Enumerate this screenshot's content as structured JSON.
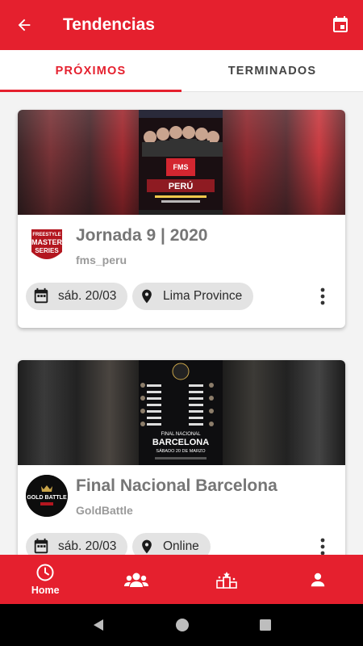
{
  "app_bar": {
    "title": "Tendencias",
    "back_icon": "arrow-back-icon",
    "calendar_icon": "calendar-icon"
  },
  "tabs": [
    {
      "label": "PRÓXIMOS",
      "active": true
    },
    {
      "label": "TERMINADOS",
      "active": false
    }
  ],
  "events": [
    {
      "title": "Jornada 9 | 2020",
      "organizer": "fms_peru",
      "logo_text": [
        "FREESTYLE",
        "MASTER",
        "SERIES"
      ],
      "date": "sáb. 20/03",
      "location": "Lima Province",
      "poster_text": [
        "FMS",
        "PERÚ"
      ]
    },
    {
      "title": "Final Nacional Barcelona",
      "organizer": "GoldBattle",
      "logo_text": [
        "GOLD BATTLE"
      ],
      "date": "sáb. 20/03",
      "location": "Online",
      "poster_text": [
        "FINAL NACIONAL",
        "BARCELONA",
        "SÁBADO 20 DE MARZO"
      ]
    }
  ],
  "bottom_nav": [
    {
      "label": "Home",
      "icon": "clock-icon",
      "active": true
    },
    {
      "label": "",
      "icon": "group-icon",
      "active": false
    },
    {
      "label": "",
      "icon": "podium-icon",
      "active": false
    },
    {
      "label": "",
      "icon": "person-icon",
      "active": false
    }
  ],
  "system_nav": [
    "back-triangle-icon",
    "home-circle-icon",
    "recents-square-icon"
  ],
  "colors": {
    "primary": "#e5202e",
    "chip_bg": "#e3e3e3",
    "title_gray": "#767676"
  }
}
